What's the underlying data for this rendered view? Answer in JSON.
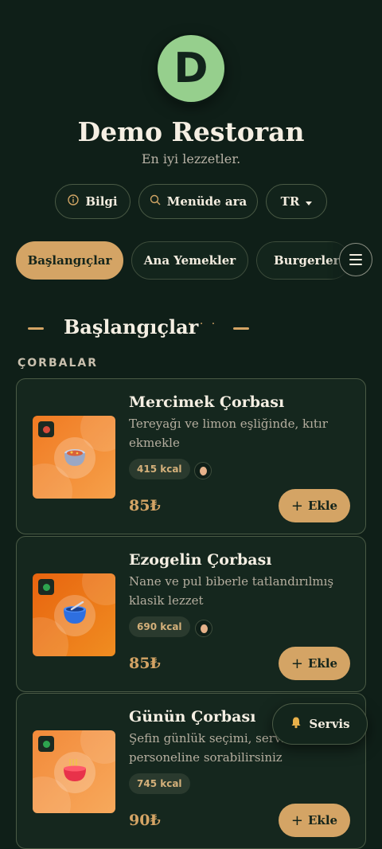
{
  "header": {
    "logo_letter": "D",
    "title": "Demo Restoran",
    "subtitle": "En iyi lezzetler."
  },
  "actions": {
    "info_label": "Bilgi",
    "search_label": "Menüde ara",
    "language_label": "TR"
  },
  "categories": [
    "Başlangıçlar",
    "Ana Yemekler",
    "Burgerler"
  ],
  "section": {
    "title": "Başlangıçlar",
    "dots": "· · ·",
    "subheading": "ÇORBALAR"
  },
  "dishes": [
    {
      "name": "Mercimek Çorbası",
      "description": "Tereyağı ve limon eşliğinde, kıtır ekmekle",
      "kcal": "415 kcal",
      "price": "85₺",
      "add_label": "Ekle",
      "icon": "soup-pot-icon",
      "thumb_color": "#f0852d"
    },
    {
      "name": "Ezogelin Çorbası",
      "description": "Nane ve pul biberle tatlandırılmış klasik lezzet",
      "kcal": "690 kcal",
      "price": "85₺",
      "add_label": "Ekle",
      "icon": "soup-bowl-icon",
      "thumb_color": "#ee7a18"
    },
    {
      "name": "Günün Çorbası",
      "description": "Şefin günlük seçimi, servis personeline sorabilirsiniz",
      "kcal": "745 kcal",
      "price": "90₺",
      "add_label": "Ekle",
      "icon": "noodle-bowl-icon",
      "thumb_color": "#f39a4a"
    }
  ],
  "service_button": {
    "label": "Servis",
    "icon": "bell-icon"
  },
  "colors": {
    "background": "#0f1f18",
    "accent": "#d4a465",
    "logo": "#96cf8d",
    "veg_dot": "#2ea44f"
  }
}
